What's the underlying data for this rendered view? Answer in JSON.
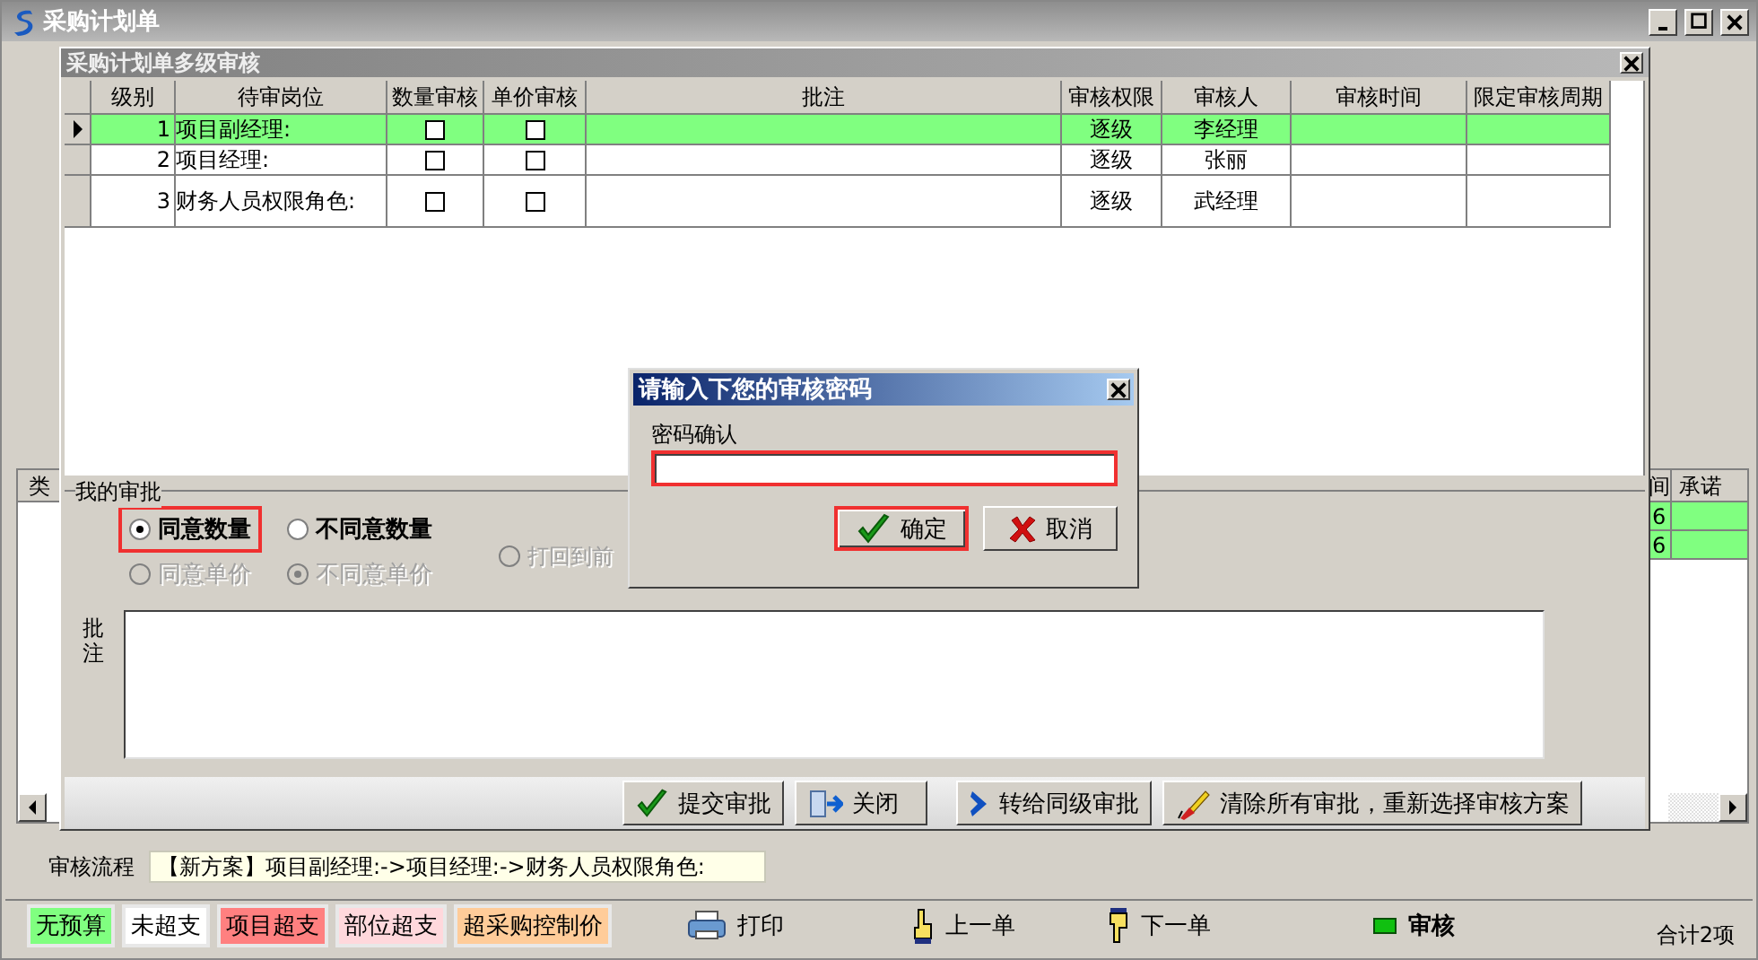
{
  "window": {
    "title": "采购计划单"
  },
  "background_grid": {
    "columns": [
      "类",
      "间",
      "承诺"
    ],
    "rows": [
      {
        "reading": "6"
      },
      {
        "reading": "6"
      }
    ]
  },
  "audit_window": {
    "title": "采购计划单多级审核",
    "table": {
      "columns": [
        "级别",
        "待审岗位",
        "数量审核",
        "单价审核",
        "批注",
        "审核权限",
        "审核人",
        "审核时间",
        "限定审核周期"
      ],
      "rows": [
        {
          "selected": true,
          "rank": "1",
          "post": "项目副经理:",
          "qty_check": false,
          "price_check": false,
          "authority": "逐级",
          "reviewer": "李经理"
        },
        {
          "selected": false,
          "rank": "2",
          "post": "项目经理:",
          "qty_check": false,
          "price_check": false,
          "authority": "逐级",
          "reviewer": "张丽"
        },
        {
          "selected": false,
          "rank": "3",
          "post": "财务人员权限角色:",
          "qty_check": false,
          "price_check": false,
          "authority": "逐级",
          "reviewer": "武经理"
        }
      ]
    },
    "my_approval": {
      "title": "我的审批",
      "options": [
        {
          "label": "同意数量",
          "selected": true,
          "disabled": false,
          "highlighted": true
        },
        {
          "label": "不同意数量",
          "selected": false,
          "disabled": false,
          "highlighted": false
        },
        {
          "label": "同意单价",
          "selected": false,
          "disabled": true,
          "highlighted": false
        },
        {
          "label": "不同意单价",
          "selected": true,
          "disabled": true,
          "highlighted": false
        },
        {
          "label": "打回到前",
          "selected": false,
          "disabled": true,
          "highlighted": false
        }
      ],
      "note_label": "批注"
    },
    "buttons": [
      {
        "label": "提交审批",
        "kind": "check"
      },
      {
        "label": "关闭",
        "kind": "door"
      },
      {
        "label": "转给同级审批",
        "kind": "chevron"
      },
      {
        "label": "清除所有审批，重新选择审核方案",
        "kind": "brush"
      }
    ]
  },
  "password_dialog": {
    "title": "请输入下您的审核密码",
    "label": "密码确认",
    "field_highlighted": true,
    "buttons": [
      {
        "label": "确定",
        "kind": "check",
        "highlighted": true
      },
      {
        "label": "取消",
        "kind": "cross",
        "highlighted": false
      }
    ]
  },
  "flow": {
    "label": "审核流程",
    "text": "【新方案】项目副经理:->项目经理:->财务人员权限角色:"
  },
  "legend": [
    {
      "label": "无预算",
      "color": "#80ff80"
    },
    {
      "label": "未超支",
      "color": "#ffffff"
    },
    {
      "label": "项目超支",
      "color": "#ff8080"
    },
    {
      "label": "部位超支",
      "color": "#ffd8dc"
    },
    {
      "label": "超采购控制价",
      "color": "#ffcc99"
    }
  ],
  "toolbar": [
    {
      "label": "打印",
      "kind": "printer",
      "bold": false
    },
    {
      "label": "上一单",
      "kind": "hand-up",
      "bold": false
    },
    {
      "label": "下一单",
      "kind": "hand-down",
      "bold": false
    },
    {
      "label": "审核",
      "kind": "led",
      "bold": true
    }
  ],
  "total": "合计2项"
}
